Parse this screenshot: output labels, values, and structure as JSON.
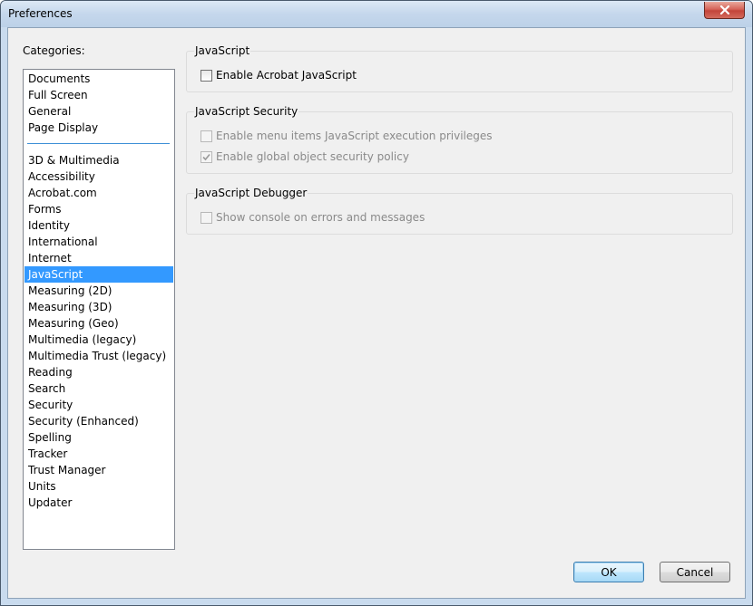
{
  "window": {
    "title": "Preferences"
  },
  "categories": {
    "label": "Categories:",
    "top_items": [
      "Documents",
      "Full Screen",
      "General",
      "Page Display"
    ],
    "items": [
      "3D & Multimedia",
      "Accessibility",
      "Acrobat.com",
      "Forms",
      "Identity",
      "International",
      "Internet",
      "JavaScript",
      "Measuring (2D)",
      "Measuring (3D)",
      "Measuring (Geo)",
      "Multimedia (legacy)",
      "Multimedia Trust (legacy)",
      "Reading",
      "Search",
      "Security",
      "Security (Enhanced)",
      "Spelling",
      "Tracker",
      "Trust Manager",
      "Units",
      "Updater"
    ],
    "selected": "JavaScript"
  },
  "panel": {
    "javascript": {
      "title": "JavaScript",
      "enable_label": "Enable Acrobat JavaScript",
      "enable_checked": false
    },
    "security": {
      "title": "JavaScript Security",
      "menu_privileges_label": "Enable menu items JavaScript execution privileges",
      "menu_privileges_checked": false,
      "global_policy_label": "Enable global object security policy",
      "global_policy_checked": true
    },
    "debugger": {
      "title": "JavaScript Debugger",
      "console_label": "Show console on errors and messages",
      "console_checked": false
    }
  },
  "buttons": {
    "ok": "OK",
    "cancel": "Cancel"
  },
  "colors": {
    "selection": "#3399ff",
    "separator": "#3d8fd6",
    "close_button": "#c3443a"
  }
}
